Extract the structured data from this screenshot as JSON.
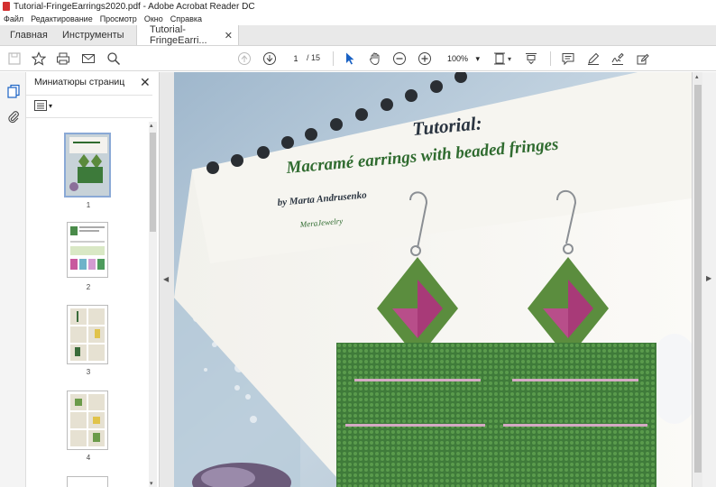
{
  "window": {
    "title": "Tutorial-FringeEarrings2020.pdf - Adobe Acrobat Reader DC"
  },
  "menu": [
    "Файл",
    "Редактирование",
    "Просмотр",
    "Окно",
    "Справка"
  ],
  "tabs": {
    "home": "Главная",
    "tools": "Инструменты",
    "document": "Tutorial-FringeEarri..."
  },
  "toolbar": {
    "page_current": "1",
    "page_total": "/ 15",
    "zoom": "100%"
  },
  "thumbnails": {
    "header": "Миниатюры страниц",
    "pages": [
      "1",
      "2",
      "3",
      "4"
    ]
  },
  "document": {
    "title": "Tutorial:",
    "subtitle": "Macramé earrings with beaded fringes",
    "author": "by Marta Andrusenko",
    "brand": "MeraJewelry"
  },
  "colors": {
    "accent_green": "#2f6b2f",
    "title_dark": "#2a3440",
    "doc_bg": "#6a7078",
    "selected_thumb_border": "#8aa9d6"
  }
}
